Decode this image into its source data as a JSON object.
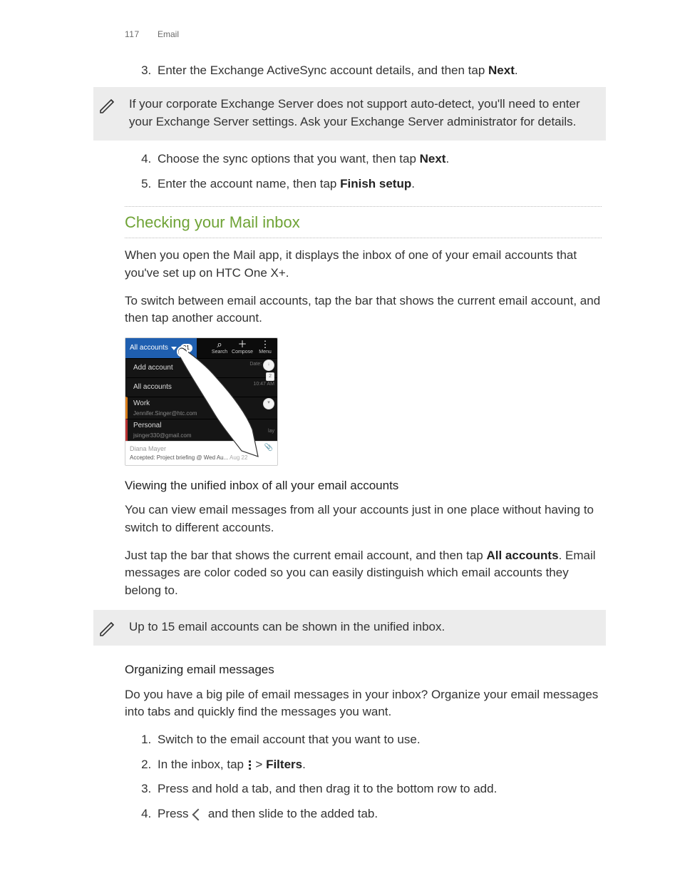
{
  "header": {
    "page": "117",
    "section": "Email"
  },
  "step3": {
    "pre": "Enter the Exchange ActiveSync account details, and then tap ",
    "bold": "Next",
    "post": "."
  },
  "note1": "If your corporate Exchange Server does not support auto-detect, you'll need to enter your Exchange Server settings. Ask your Exchange Server administrator for details.",
  "step4": {
    "pre": "Choose the sync options that you want, then tap ",
    "bold": "Next",
    "post": "."
  },
  "step5": {
    "pre": "Enter the account name, then tap ",
    "bold": "Finish setup",
    "post": "."
  },
  "sec1": {
    "title": "Checking your Mail inbox",
    "p1": "When you open the Mail app, it displays the inbox of one of your email accounts that you've set up on HTC One X+.",
    "p2": "To switch between email accounts, tap the bar that shows the current email account, and then tap another account."
  },
  "shot": {
    "acc": "All accounts",
    "badge": "31",
    "search": "Search",
    "compose": "Compose",
    "menu": "Menu",
    "date_lbl": "Date:",
    "count": "2",
    "time": "10:47 AM",
    "add": "Add account",
    "all": "All accounts",
    "work": "Work",
    "work_sub": "Jennifer.Singer@htc.com",
    "per": "Personal",
    "per_sub": "jsinger330@gmail.com",
    "lay": "lay",
    "msg_name": "Diana Mayer",
    "msg_sub": "Accepted: Project briefing @ Wed Au...",
    "msg_date": "Aug 22"
  },
  "sub1": {
    "title": "Viewing the unified inbox of all your email accounts",
    "p1": "You can view email messages from all your accounts just in one place without having to switch to different accounts.",
    "p2a": "Just tap the bar that shows the current email account, and then tap ",
    "p2b": "All accounts",
    "p2c": ". Email messages are color coded so you can easily distinguish which email accounts they belong to."
  },
  "note2": "Up to 15 email accounts can be shown in the unified inbox.",
  "sub2": {
    "title": "Organizing email messages",
    "p1": "Do you have a big pile of email messages in your inbox? Organize your email messages into tabs and quickly find the messages you want.",
    "s1": "Switch to the email account that you want to use.",
    "s2a": "In the inbox, tap ",
    "s2b": " > ",
    "s2c": "Filters",
    "s2d": ".",
    "s3": "Press and hold a tab, and then drag it to the bottom row to add.",
    "s4a": "Press ",
    "s4b": " and then slide to the added tab."
  }
}
